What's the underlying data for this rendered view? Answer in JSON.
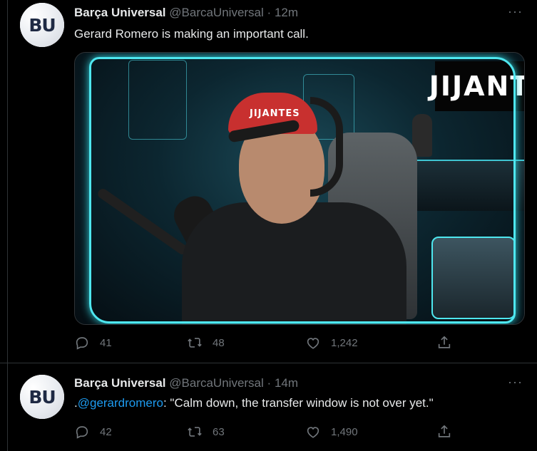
{
  "tweets": [
    {
      "name": "Barça Universal",
      "handle": "@BarcaUniversal",
      "separator": "·",
      "time": "12m",
      "text": "Gerard Romero is making an important call.",
      "media": {
        "brand_text": "JIJANT",
        "cap_text": "JIJANTES"
      },
      "actions": {
        "replies": "41",
        "retweets": "48",
        "likes": "1,242"
      }
    },
    {
      "name": "Barça Universal",
      "handle": "@BarcaUniversal",
      "separator": "·",
      "time": "14m",
      "text_prefix": ".",
      "mention": "@gerardromero",
      "text_suffix": ": \"Calm down, the transfer window is not over yet.\"",
      "actions": {
        "replies": "42",
        "retweets": "63",
        "likes": "1,490"
      }
    }
  ],
  "avatar_monogram": "BU",
  "more_icon": "···",
  "icons": {
    "reply": "reply-icon",
    "retweet": "retweet-icon",
    "like": "like-icon",
    "share": "share-icon"
  },
  "colors": {
    "mention": "#1d9bf0",
    "muted": "#71767b",
    "frame_glow": "#4ee7ef"
  }
}
